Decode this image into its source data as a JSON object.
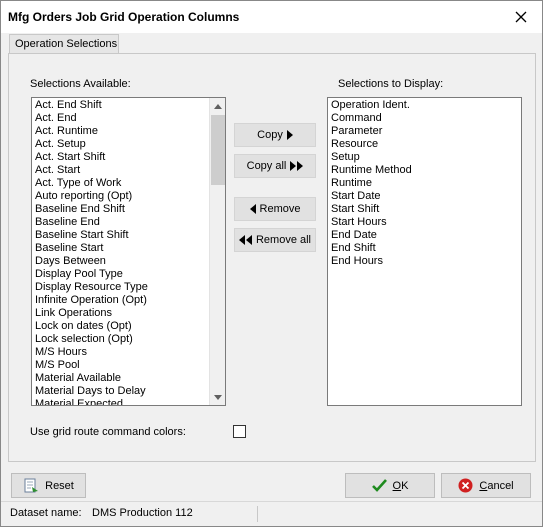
{
  "window": {
    "title": "Mfg Orders Job Grid Operation Columns",
    "close_icon": "close-icon"
  },
  "tab": {
    "label": "Operation Selections"
  },
  "available": {
    "label": "Selections Available:",
    "items": [
      "Act. End Shift",
      "Act. End",
      "Act. Runtime",
      "Act. Setup",
      "Act. Start Shift",
      "Act. Start",
      "Act. Type of Work",
      "Auto reporting (Opt)",
      "Baseline End Shift",
      "Baseline End",
      "Baseline Start Shift",
      "Baseline Start",
      "Days Between",
      "Display Pool Type",
      "Display Resource Type",
      "Infinite Operation (Opt)",
      "Link Operations",
      "Lock on dates (Opt)",
      "Lock selection (Opt)",
      "M/S Hours",
      "M/S Pool",
      "Material Available",
      "Material Days to Delay",
      "Material Expected"
    ]
  },
  "display": {
    "label": "Selections to Display:",
    "items": [
      "Operation Ident.",
      "Command",
      "Parameter",
      "Resource",
      "Setup",
      "Runtime Method",
      "Runtime",
      "Start Date",
      "Start Shift",
      "Start Hours",
      "End Date",
      "End Shift",
      "End Hours"
    ]
  },
  "buttons": {
    "copy": "Copy",
    "copy_all": "Copy all",
    "remove": "Remove",
    "remove_all": "Remove all"
  },
  "option": {
    "label": "Use grid route command colors:",
    "checked": false
  },
  "footer": {
    "reset": "Reset",
    "ok_mnemonic": "O",
    "ok_rest": "K",
    "cancel_mnemonic": "C",
    "cancel_rest": "ancel"
  },
  "status": {
    "dataset_label": "Dataset name:",
    "dataset_value": "DMS Production 112"
  },
  "colors": {
    "ok_check": "#1e8a1e",
    "cancel_icon": "#d02020",
    "accent": "#000000"
  }
}
